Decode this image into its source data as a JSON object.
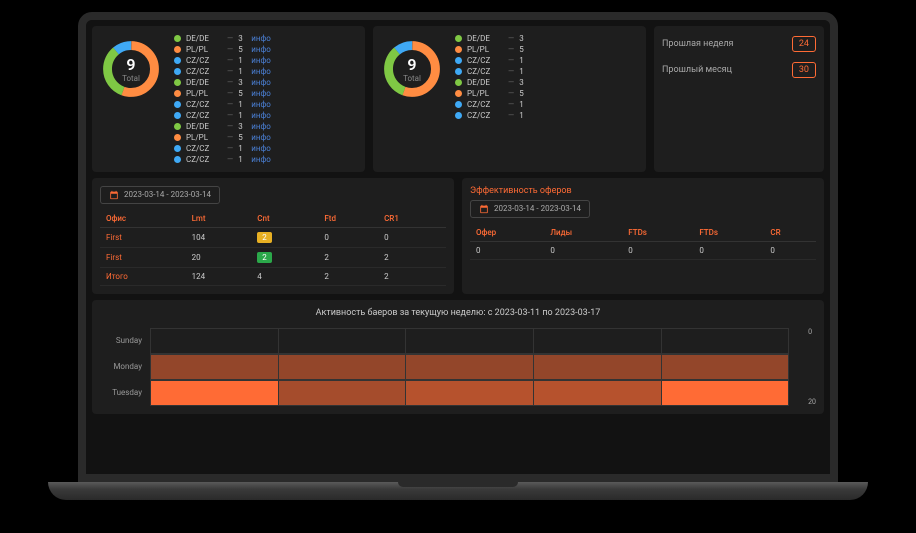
{
  "colors": {
    "green": "#7fc844",
    "orange": "#ff8c42",
    "blue": "#3fa9f5",
    "accent": "#ff6b35"
  },
  "donuts": [
    {
      "value": "9",
      "label": "Total",
      "legend": [
        {
          "color": "#7fc844",
          "label": "DE/DE",
          "value": "3",
          "link": "инфо"
        },
        {
          "color": "#ff8c42",
          "label": "PL/PL",
          "value": "5",
          "link": "инфо"
        },
        {
          "color": "#3fa9f5",
          "label": "CZ/CZ",
          "value": "1",
          "link": "инфо"
        },
        {
          "color": "#3fa9f5",
          "label": "CZ/CZ",
          "value": "1",
          "link": "инфо"
        },
        {
          "color": "#7fc844",
          "label": "DE/DE",
          "value": "3",
          "link": "инфо"
        },
        {
          "color": "#ff8c42",
          "label": "PL/PL",
          "value": "5",
          "link": "инфо"
        },
        {
          "color": "#3fa9f5",
          "label": "CZ/CZ",
          "value": "1",
          "link": "инфо"
        },
        {
          "color": "#3fa9f5",
          "label": "CZ/CZ",
          "value": "1",
          "link": "инфо"
        },
        {
          "color": "#7fc844",
          "label": "DE/DE",
          "value": "3",
          "link": "инфо"
        },
        {
          "color": "#ff8c42",
          "label": "PL/PL",
          "value": "5",
          "link": "инфо"
        },
        {
          "color": "#3fa9f5",
          "label": "CZ/CZ",
          "value": "1",
          "link": "инфо"
        },
        {
          "color": "#3fa9f5",
          "label": "CZ/CZ",
          "value": "1",
          "link": "инфо"
        }
      ]
    },
    {
      "value": "9",
      "label": "Total",
      "legend": [
        {
          "color": "#7fc844",
          "label": "DE/DE",
          "value": "3"
        },
        {
          "color": "#ff8c42",
          "label": "PL/PL",
          "value": "5"
        },
        {
          "color": "#3fa9f5",
          "label": "CZ/CZ",
          "value": "1"
        },
        {
          "color": "#3fa9f5",
          "label": "CZ/CZ",
          "value": "1"
        },
        {
          "color": "#7fc844",
          "label": "DE/DE",
          "value": "3"
        },
        {
          "color": "#ff8c42",
          "label": "PL/PL",
          "value": "5"
        },
        {
          "color": "#3fa9f5",
          "label": "CZ/CZ",
          "value": "1"
        },
        {
          "color": "#3fa9f5",
          "label": "CZ/CZ",
          "value": "1"
        }
      ]
    }
  ],
  "side_stats": [
    {
      "label": "Прошлая неделя",
      "value": "24"
    },
    {
      "label": "Прошлый месяц",
      "value": "30"
    }
  ],
  "office_table": {
    "date_range": "2023-03-14 - 2023-03-14",
    "headers": [
      "Офис",
      "Lmt",
      "Cnt",
      "Ftd",
      "CR1"
    ],
    "rows": [
      {
        "name": "First",
        "lmt": "104",
        "cnt": "2",
        "cnt_color": "yellow",
        "ftd": "0",
        "cr1": "0"
      },
      {
        "name": "First",
        "lmt": "20",
        "cnt": "2",
        "cnt_color": "green",
        "ftd": "2",
        "cr1": "2"
      }
    ],
    "total": {
      "label": "Итого",
      "lmt": "124",
      "cnt": "4",
      "ftd": "2",
      "cr1": "2"
    }
  },
  "offers_table": {
    "title": "Эффективность оферов",
    "date_range": "2023-03-14 - 2023-03-14",
    "headers": [
      "Офер",
      "Лиды",
      "FTDs",
      "FTDs",
      "CR"
    ],
    "rows": [
      {
        "c0": "0",
        "c1": "0",
        "c2": "0",
        "c3": "0",
        "c4": "0"
      }
    ]
  },
  "heatmap": {
    "title": "Активность баеров за текущую неделю: с 2023-03-11 по 2023-03-17",
    "days": [
      "Sunday",
      "Monday",
      "Tuesday"
    ],
    "scale": {
      "min": "0",
      "max": "20"
    }
  },
  "chart_data": [
    {
      "type": "pie",
      "title": "Total",
      "total": 9,
      "series": [
        {
          "name": "DE/DE",
          "value": 3,
          "color": "#7fc844"
        },
        {
          "name": "PL/PL",
          "value": 5,
          "color": "#ff8c42"
        },
        {
          "name": "CZ/CZ",
          "value": 1,
          "color": "#3fa9f5"
        }
      ]
    },
    {
      "type": "pie",
      "title": "Total",
      "total": 9,
      "series": [
        {
          "name": "DE/DE",
          "value": 3,
          "color": "#7fc844"
        },
        {
          "name": "PL/PL",
          "value": 5,
          "color": "#ff8c42"
        },
        {
          "name": "CZ/CZ",
          "value": 1,
          "color": "#3fa9f5"
        }
      ]
    },
    {
      "type": "heatmap",
      "title": "Активность баеров за текущую неделю: с 2023-03-11 по 2023-03-17",
      "y": [
        "Sunday",
        "Monday",
        "Tuesday"
      ],
      "x_cols": 5,
      "values": [
        [
          0,
          0,
          0,
          0,
          0
        ],
        [
          8,
          8,
          8,
          8,
          8
        ],
        [
          20,
          10,
          12,
          12,
          20
        ]
      ],
      "scale": [
        0,
        20
      ]
    }
  ]
}
